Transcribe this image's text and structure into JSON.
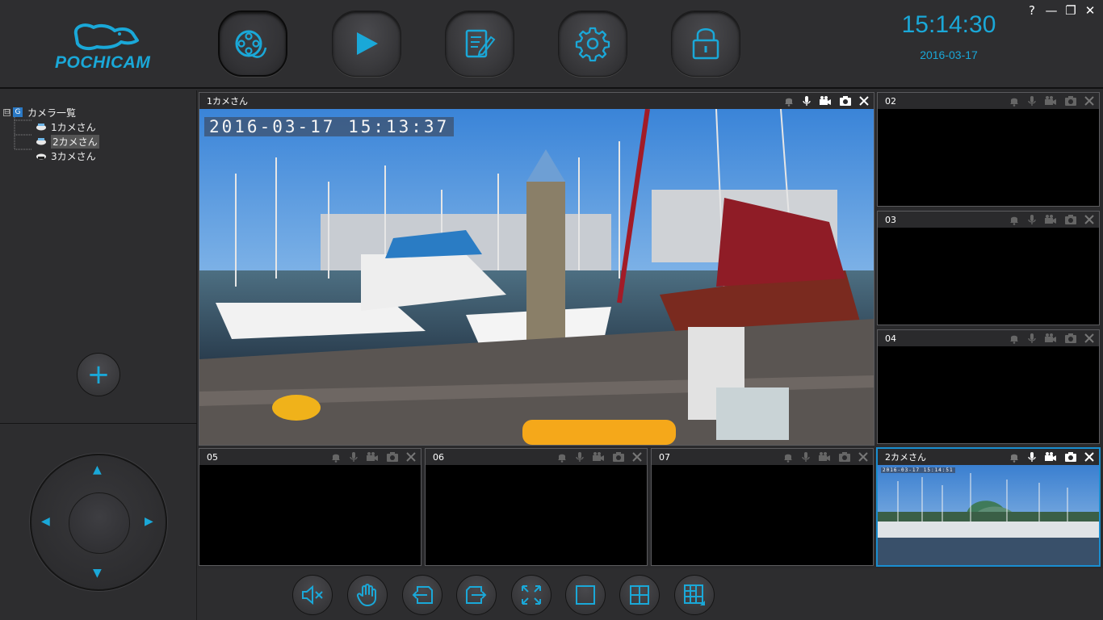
{
  "app": {
    "logo_text": "POCHICAM",
    "clock": "15:14:30",
    "date": "2016-03-17",
    "accent_color": "#1aa8d8",
    "window_controls": [
      "?",
      "—",
      "❐",
      "✕"
    ]
  },
  "toolbar": {
    "buttons": [
      {
        "name": "live-view",
        "icon": "film-reel-icon",
        "active": true
      },
      {
        "name": "playback",
        "icon": "play-icon",
        "active": false
      },
      {
        "name": "log",
        "icon": "document-edit-icon",
        "active": false
      },
      {
        "name": "settings",
        "icon": "gear-icon",
        "active": false
      },
      {
        "name": "lock",
        "icon": "lock-icon",
        "active": false
      }
    ]
  },
  "tree": {
    "toggle": "⊟",
    "root_badge": "G",
    "root_label": "カメラ一覧",
    "cameras": [
      {
        "label": "1カメさん",
        "selected": false
      },
      {
        "label": "2カメさん",
        "selected": true
      },
      {
        "label": "3カメさん",
        "selected": false
      }
    ]
  },
  "left": {
    "add_label": "+"
  },
  "ptz": {
    "up": "▲",
    "down": "▼",
    "left": "◀",
    "right": "▶"
  },
  "tiles": {
    "main": {
      "title": "1カメさん",
      "osd": "2016-03-17  15:13:37"
    },
    "t02": {
      "title": "02"
    },
    "t03": {
      "title": "03"
    },
    "t04": {
      "title": "04"
    },
    "t05": {
      "title": "05"
    },
    "t06": {
      "title": "06"
    },
    "t07": {
      "title": "07"
    },
    "t08": {
      "title": "2カメさん",
      "osd": "2016-03-17  15:14:51"
    }
  },
  "bottom_buttons": [
    {
      "name": "mute",
      "icon": "speaker-mute-icon"
    },
    {
      "name": "ptz-hand",
      "icon": "hand-icon"
    },
    {
      "name": "prev-page",
      "icon": "page-prev-icon"
    },
    {
      "name": "next-page",
      "icon": "page-next-icon"
    },
    {
      "name": "fullscreen",
      "icon": "fullscreen-icon"
    },
    {
      "name": "layout-1",
      "icon": "single-view-icon"
    },
    {
      "name": "layout-4",
      "icon": "quad-view-icon"
    },
    {
      "name": "layout-8",
      "icon": "multi-view-icon"
    }
  ]
}
